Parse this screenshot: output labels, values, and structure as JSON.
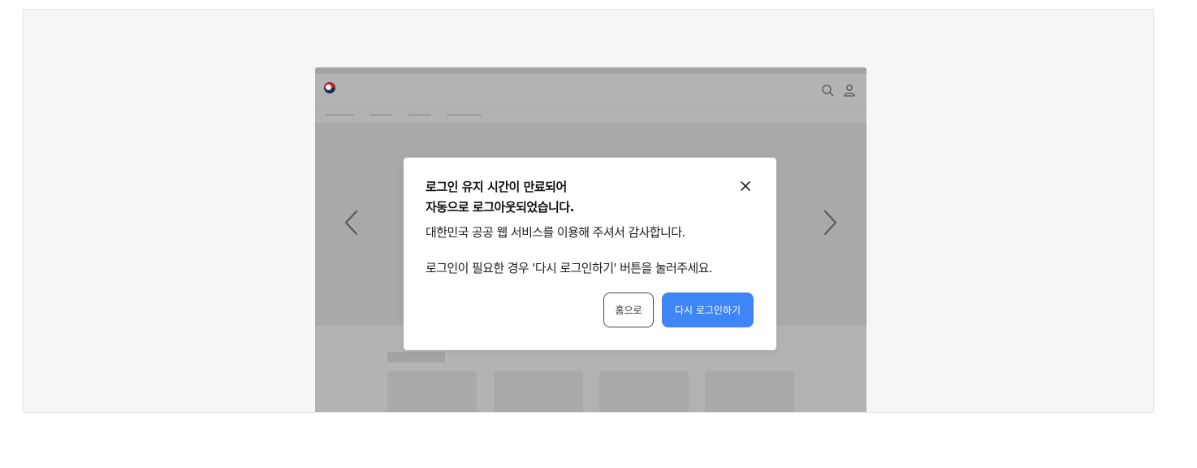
{
  "modal": {
    "title_line1": "로그인 유지 시간이 만료되어",
    "title_line2": "자동으로 로그아웃되었습니다.",
    "message_line1": "대한민국 공공 웹 서비스를 이용해 주셔서 감사합니다.",
    "message_line2": "로그인이 필요한 경우 '다시 로그인하기' 버튼을 눌러주세요.",
    "home_button_label": "홈으로",
    "login_button_label": "다시 로그인하기"
  },
  "icons": {
    "logo": "taegeuk-logo-icon",
    "search": "search-icon",
    "user": "user-icon",
    "prev": "chevron-left-icon",
    "next": "chevron-right-icon",
    "close": "close-icon"
  },
  "colors": {
    "primary_button": "#3e86f5",
    "overlay": "#b3b3b3",
    "page_background": "#f6f6f6"
  }
}
